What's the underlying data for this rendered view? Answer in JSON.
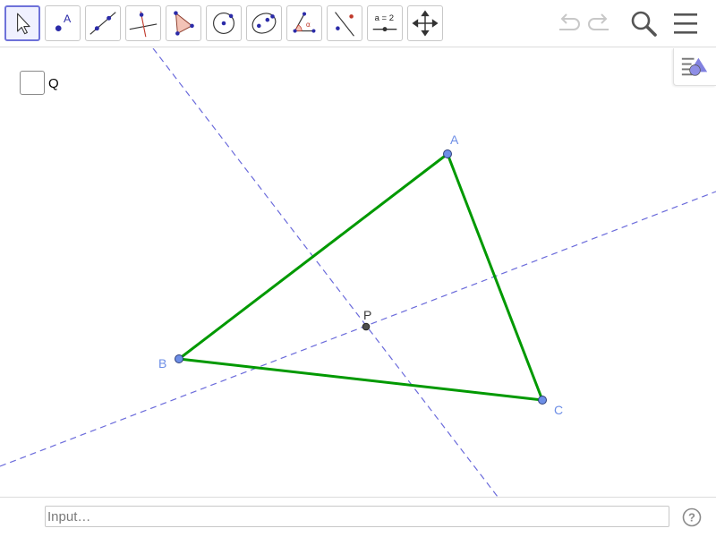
{
  "toolbar": {
    "tools": [
      {
        "name": "move-tool",
        "icon": "arrow-pointer-icon",
        "selected": true
      },
      {
        "name": "point-tool",
        "icon": "point-icon",
        "label": "A"
      },
      {
        "name": "line-tool",
        "icon": "line-through-two-points-icon"
      },
      {
        "name": "perpendicular-line-tool",
        "icon": "perpendicular-line-icon"
      },
      {
        "name": "polygon-tool",
        "icon": "polygon-icon"
      },
      {
        "name": "circle-tool",
        "icon": "circle-with-center-icon"
      },
      {
        "name": "ellipse-tool",
        "icon": "ellipse-icon"
      },
      {
        "name": "angle-tool",
        "icon": "angle-icon",
        "label": "α"
      },
      {
        "name": "reflect-tool",
        "icon": "reflect-about-line-icon"
      },
      {
        "name": "slider-tool",
        "icon": "slider-icon",
        "label": "a = 2"
      },
      {
        "name": "move-graphics-tool",
        "icon": "move-graphics-view-icon"
      }
    ],
    "right": [
      "undo-icon",
      "redo-icon",
      "search-icon",
      "menu-icon"
    ]
  },
  "checkbox": {
    "label": "Q",
    "checked": false
  },
  "points": {
    "A": {
      "label": "A"
    },
    "B": {
      "label": "B"
    },
    "C": {
      "label": "C"
    },
    "P": {
      "label": "P"
    }
  },
  "inputbar": {
    "placeholder": "Input…",
    "help_label": "?"
  },
  "colors": {
    "triangle": "#009900",
    "points": "#6d8ee6",
    "dashed_lines": "#6b6bdb",
    "labels": "#6d8ee6",
    "point_p": "#4d4d4d",
    "selected_tool": "#6e72d9"
  }
}
